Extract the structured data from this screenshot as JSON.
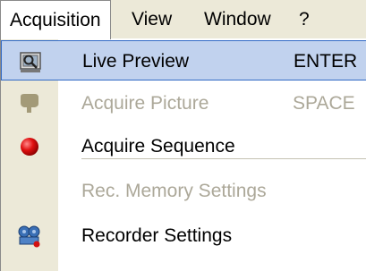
{
  "menubar": {
    "items": [
      {
        "label": "Acquisition",
        "open": true
      },
      {
        "label": "View"
      },
      {
        "label": "Window"
      },
      {
        "label": "?"
      }
    ]
  },
  "dropdown": {
    "items": [
      {
        "label": "Live Preview",
        "shortcut": "ENTER",
        "icon": "live-preview-icon",
        "state": "highlighted"
      },
      {
        "label": "Acquire Picture",
        "shortcut": "SPACE",
        "icon": "acquire-picture-icon",
        "state": "disabled"
      },
      {
        "label": "Acquire Sequence",
        "icon": "record-icon",
        "state": "enabled"
      },
      {
        "label": "Rec. Memory Settings",
        "state": "disabled"
      },
      {
        "label": "Recorder Settings",
        "icon": "recorder-settings-icon",
        "state": "enabled"
      }
    ]
  },
  "colors": {
    "menubar_bg": "#ece9d8",
    "highlight_bg": "#c1d2ee",
    "highlight_border": "#316ac5",
    "disabled_text": "#aca899"
  }
}
